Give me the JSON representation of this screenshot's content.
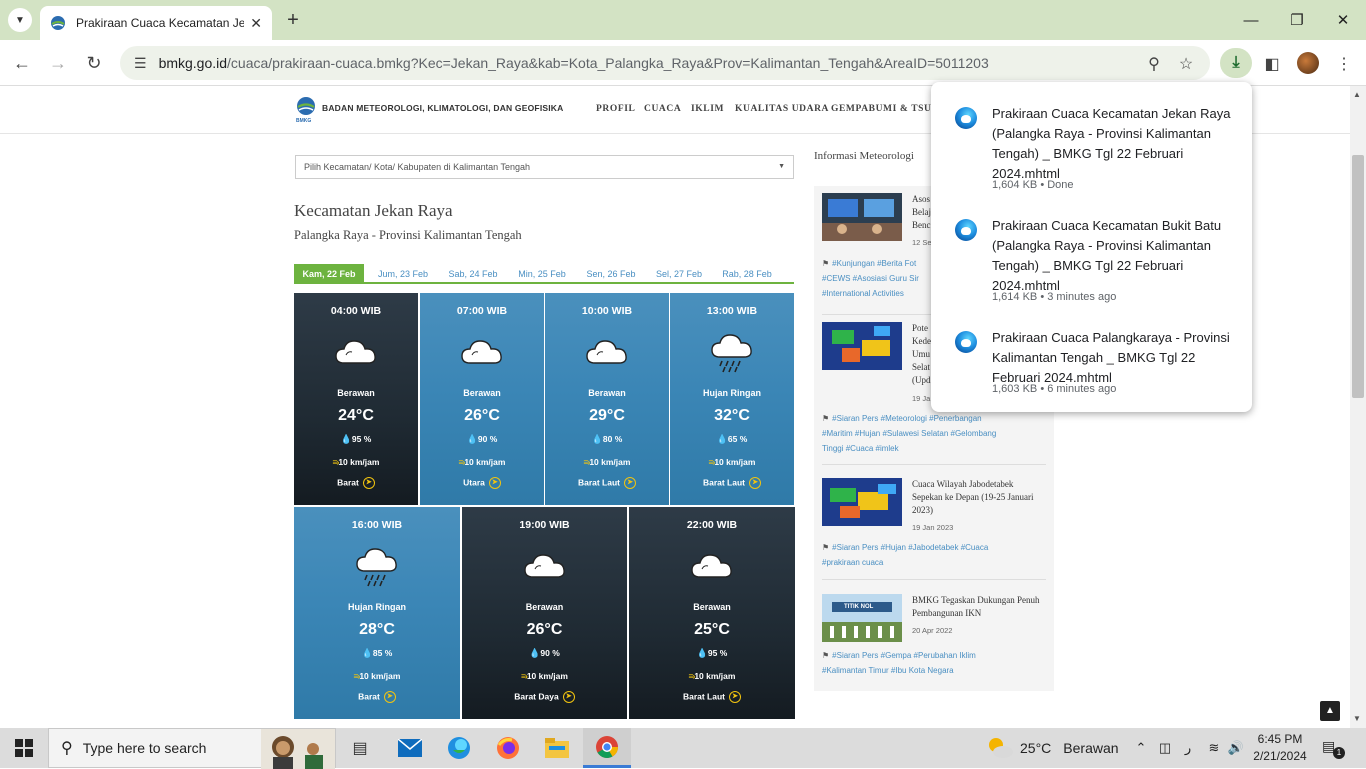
{
  "browser": {
    "tab_title": "Prakiraan Cuaca Kecamatan Jek",
    "url_host": "bmkg.go.id",
    "url_path": "/cuaca/prakiraan-cuaca.bmkg?Kec=Jekan_Raya&kab=Kota_Palangka_Raya&Prov=Kalimantan_Tengah&AreaID=5011203"
  },
  "site": {
    "brand": "BADAN METEOROLOGI, KLIMATOLOGI, DAN GEOFISIKA",
    "logo_text": "BMKG",
    "menu": [
      "PROFIL",
      "CUACA",
      "IKLIM",
      "KUALITAS UDARA",
      "GEMPABUMI & TSUNA"
    ]
  },
  "main": {
    "select_placeholder": "Pilih Kecamatan/ Kota/ Kabupaten di Kalimantan Tengah",
    "title": "Kecamatan Jekan Raya",
    "subtitle": "Palangka Raya - Provinsi Kalimantan Tengah",
    "day_tabs": [
      "Kam, 22 Feb",
      "Jum, 23 Feb",
      "Sab, 24 Feb",
      "Min, 25 Feb",
      "Sen, 26 Feb",
      "Sel, 27 Feb",
      "Rab, 28 Feb"
    ],
    "forecasts": [
      {
        "time": "04:00 WIB",
        "condition": "Berawan",
        "temp": "24°C",
        "humidity": "95 %",
        "wind": "10 km/jam",
        "direction": "Barat",
        "theme": "night",
        "icon": "cloudy-icon"
      },
      {
        "time": "07:00 WIB",
        "condition": "Berawan",
        "temp": "26°C",
        "humidity": "90 %",
        "wind": "10 km/jam",
        "direction": "Utara",
        "theme": "day",
        "icon": "cloudy-icon"
      },
      {
        "time": "10:00 WIB",
        "condition": "Berawan",
        "temp": "29°C",
        "humidity": "80 %",
        "wind": "10 km/jam",
        "direction": "Barat Laut",
        "theme": "day",
        "icon": "cloudy-icon"
      },
      {
        "time": "13:00 WIB",
        "condition": "Hujan Ringan",
        "temp": "32°C",
        "humidity": "65 %",
        "wind": "10 km/jam",
        "direction": "Barat Laut",
        "theme": "day",
        "icon": "light-rain-icon"
      },
      {
        "time": "16:00 WIB",
        "condition": "Hujan Ringan",
        "temp": "28°C",
        "humidity": "85 %",
        "wind": "10 km/jam",
        "direction": "Barat",
        "theme": "day",
        "icon": "light-rain-icon"
      },
      {
        "time": "19:00 WIB",
        "condition": "Berawan",
        "temp": "26°C",
        "humidity": "90 %",
        "wind": "10 km/jam",
        "direction": "Barat Daya",
        "theme": "night",
        "icon": "cloudy-icon"
      },
      {
        "time": "22:00 WIB",
        "condition": "Berawan",
        "temp": "25°C",
        "humidity": "95 %",
        "wind": "10 km/jam",
        "direction": "Barat Laut",
        "theme": "night",
        "icon": "cloudy-icon"
      }
    ]
  },
  "sidebar": {
    "title": "Informasi Meteorologi",
    "news": [
      {
        "title": "Asos\nBelaj\nBenc",
        "date": "12 Se",
        "tags": "#Kunjungan #Berita Fot\n#CEWS #Asosiasi Guru Sir\n#International Activities"
      },
      {
        "title": "Pote\nKede\nUmu\nSelat\n(Upd",
        "date": "19 Ja",
        "tags": "#Siaran Pers #Meteorologi #Penerbangan\n#Maritim #Hujan #Sulawesi Selatan #Gelombang\nTinggi #Cuaca #imlek"
      },
      {
        "title": "Cuaca Wilayah Jabodetabek Sepekan ke Depan (19-25 Januari 2023)",
        "date": "19 Jan 2023",
        "tags": "#Siaran Pers #Hujan #Jabodetabek #Cuaca\n#prakiraan cuaca"
      },
      {
        "title": "BMKG Tegaskan Dukungan Penuh Pembangunan IKN",
        "date": "20 Apr 2022",
        "tags": "#Siaran Pers #Gempa #Perubahan Iklim\n#Kalimantan Timur #Ibu Kota Negara",
        "thumb_text": "TITIK NOL"
      }
    ]
  },
  "downloads": [
    {
      "name": "Prakiraan Cuaca Kecamatan Jekan Raya (Palangka Raya - Provinsi Kalimantan Tengah) _ BMKG Tgl 22 Februari 2024.mhtml",
      "meta": "1,604 KB • Done"
    },
    {
      "name": "Prakiraan Cuaca Kecamatan Bukit Batu (Palangka Raya - Provinsi Kalimantan Tengah) _ BMKG Tgl 22 Februari 2024.mhtml",
      "meta": "1,614 KB • 3 minutes ago"
    },
    {
      "name": "Prakiraan Cuaca Palangkaraya - Provinsi Kalimantan Tengah _ BMKG Tgl 22 Februari 2024.mhtml",
      "meta": "1,603 KB • 6 minutes ago"
    }
  ],
  "taskbar": {
    "search_placeholder": "Type here to search",
    "weather_temp": "25°C",
    "weather_text": "Berawan",
    "time": "6:45 PM",
    "date": "2/21/2024",
    "notification_count": "1"
  },
  "colors": {
    "accent_green": "#6db33f",
    "link_blue": "#4a8fc2",
    "tab_bar": "#d3e3c4"
  }
}
